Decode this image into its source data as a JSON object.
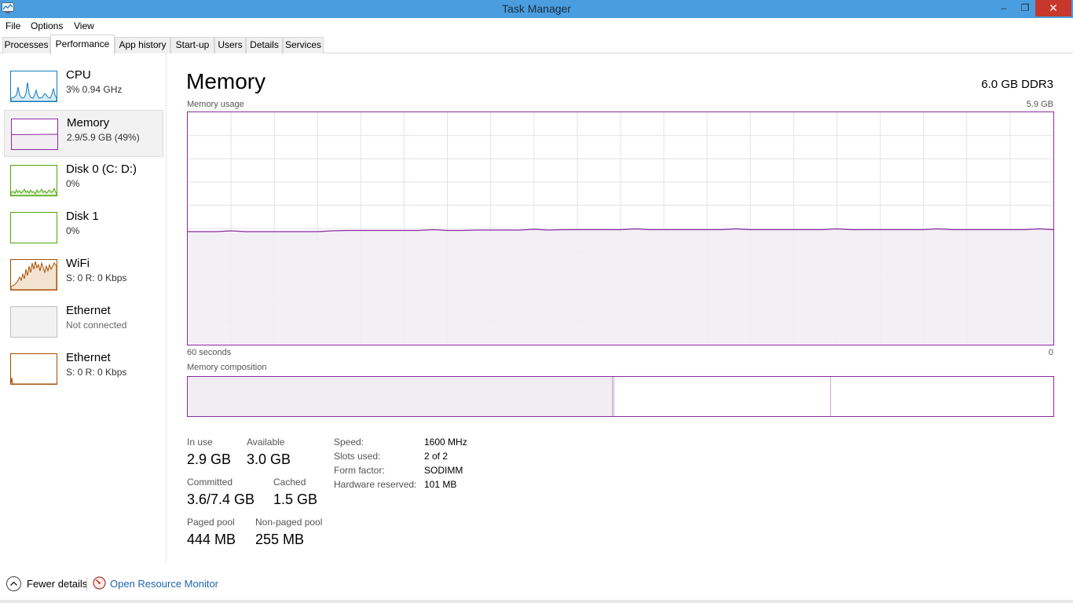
{
  "window": {
    "title": "Task Manager",
    "minimize": "‒",
    "maximize": "❐",
    "close": "✕"
  },
  "menu": [
    "File",
    "Options",
    "View"
  ],
  "tabs": [
    "Processes",
    "Performance",
    "App history",
    "Start-up",
    "Users",
    "Details",
    "Services"
  ],
  "active_tab": "Performance",
  "sidebar": {
    "items": [
      {
        "label": "CPU",
        "sub": "3% 0.94 GHz",
        "color": "#117dbb"
      },
      {
        "label": "Memory",
        "sub": "2.9/5.9 GB (49%)",
        "color": "#8b2a9f"
      },
      {
        "label": "Disk 0 (C: D:)",
        "sub": "0%",
        "color": "#4da60c"
      },
      {
        "label": "Disk 1",
        "sub": "0%",
        "color": "#4da60c"
      },
      {
        "label": "WiFi",
        "sub": "S: 0 R: 0 Kbps",
        "color": "#a74f01"
      },
      {
        "label": "Ethernet",
        "sub": "Not connected",
        "color": "#c0c0c0"
      },
      {
        "label": "Ethernet",
        "sub": "S: 0 R: 0 Kbps",
        "color": "#a74f01"
      }
    ]
  },
  "main": {
    "title": "Memory",
    "spec": "6.0 GB DDR3",
    "usage_label": "Memory usage",
    "usage_max": "5.9 GB",
    "time_label": "60 seconds",
    "time_right": "0",
    "composition_label": "Memory composition",
    "usage_fraction": 0.49,
    "composition": {
      "in_use": 0.49,
      "modified": 0.003,
      "standby": 0.25,
      "free": 0.26
    }
  },
  "stats": {
    "in_use_label": "In use",
    "in_use_value": "2.9 GB",
    "available_label": "Available",
    "available_value": "3.0 GB",
    "committed_label": "Committed",
    "committed_value": "3.6/7.4 GB",
    "cached_label": "Cached",
    "cached_value": "1.5 GB",
    "paged_label": "Paged pool",
    "paged_value": "444 MB",
    "nonpaged_label": "Non-paged pool",
    "nonpaged_value": "255 MB"
  },
  "specs": {
    "speed_label": "Speed:",
    "speed_value": "1600 MHz",
    "slots_label": "Slots used:",
    "slots_value": "2 of 2",
    "form_label": "Form factor:",
    "form_value": "SODIMM",
    "hw_label": "Hardware reserved:",
    "hw_value": "101 MB"
  },
  "footer": {
    "fewer_details": "Fewer details",
    "resource_monitor": "Open Resource Monitor"
  },
  "colors": {
    "memory": "#8b2a9f",
    "titlebar": "#4a9ee0",
    "grid": "#e7e0ea",
    "fill": "#f1edf3"
  }
}
